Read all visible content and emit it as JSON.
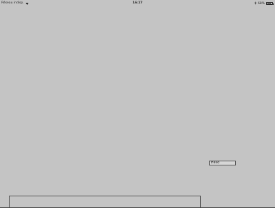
{
  "status_bar": {
    "carrier": "Réseau indisp.",
    "wifi_icon": "wifi-icon",
    "time": "16:17",
    "bluetooth_icon": "bluetooth-icon",
    "battery_percent": "68%",
    "battery_level": 0.68
  },
  "main": {
    "text_field_value": "Hello"
  }
}
